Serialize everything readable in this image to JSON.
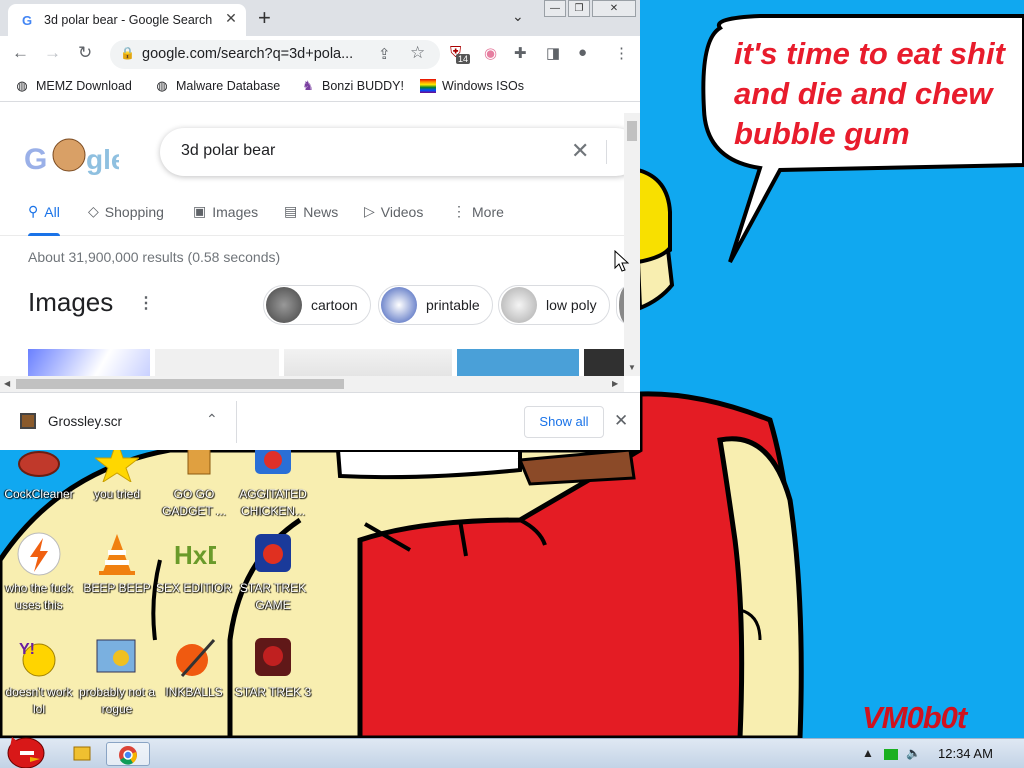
{
  "desktop": {
    "speech_bubble": "it's time to eat shit\nand die and chew\nbubble gum",
    "signature": "VM0b0t",
    "icons": [
      {
        "label": "CockCleaner",
        "icon": "broom-icon"
      },
      {
        "label": "you tried",
        "icon": "star-icon"
      },
      {
        "label": "GO GO GADGET ...",
        "icon": "folder-icon"
      },
      {
        "label": "AGGITATED CHICKEN...",
        "icon": "bird-game-icon"
      },
      {
        "label": "who the fuck uses this",
        "icon": "lightning-icon"
      },
      {
        "label": "BEEP BEEP",
        "icon": "vlc-cone-icon"
      },
      {
        "label": "SEX EDITIOR",
        "icon": "hxd-icon"
      },
      {
        "label": "STAR TREK GAME",
        "icon": "star-wars-game-icon"
      },
      {
        "label": "doesn't work lol",
        "icon": "yahoo-messenger-icon"
      },
      {
        "label": "probably not a rogue",
        "icon": "gears-icon"
      },
      {
        "label": "INKBALLS",
        "icon": "inkball-icon"
      },
      {
        "label": "STAR TREK 3",
        "icon": "star-wars-game-icon"
      }
    ]
  },
  "browser": {
    "tab_title": "3d polar bear - Google Search",
    "url": "google.com/search?q=3d+pola...",
    "extension_badge": "14",
    "bookmarks": [
      "MEMZ Download",
      "Malware Database",
      "Bonzi BUDDY!",
      "Windows ISOs"
    ],
    "search_query": "3d polar bear",
    "vertical_tabs": [
      "All",
      "Shopping",
      "Images",
      "News",
      "Videos",
      "More"
    ],
    "result_stats": "About 31,900,000 results (0.58 seconds)",
    "images_heading": "Images",
    "chips": [
      "cartoon",
      "printable",
      "low poly"
    ],
    "download_file": "Grossley.scr",
    "show_all": "Show all"
  },
  "taskbar": {
    "clock": "12:34 AM"
  },
  "colors": {
    "wallpaper_blue": "#10a8f0",
    "shirt_red": "#e41c24",
    "skin": "#f8eeb0",
    "google_blue": "#1a73e8"
  }
}
